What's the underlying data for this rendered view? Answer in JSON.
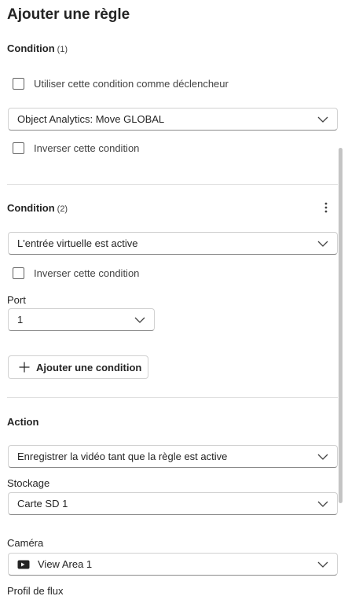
{
  "title": "Ajouter une règle",
  "condition1": {
    "label": "Condition",
    "count": "(1)",
    "trigger_checkbox_label": "Utiliser cette condition comme déclencheur",
    "select_value": "Object Analytics: Move GLOBAL",
    "invert_label": "Inverser cette condition"
  },
  "condition2": {
    "label": "Condition",
    "count": "(2)",
    "select_value": "L'entrée virtuelle est active",
    "invert_label": "Inverser cette condition",
    "port_label": "Port",
    "port_value": "1"
  },
  "add_condition_label": "Ajouter une condition",
  "action": {
    "label": "Action",
    "select_value": "Enregistrer la vidéo tant que la règle est active",
    "storage_label": "Stockage",
    "storage_value": "Carte SD 1",
    "camera_label": "Caméra",
    "camera_value": "View Area 1",
    "stream_profile_label": "Profil de flux"
  },
  "icons": {
    "dropdown": "chevron-down-icon",
    "more": "more-vertical-icon",
    "add": "plus-icon",
    "camera": "camera-icon"
  },
  "colors": {
    "text": "#242424",
    "border": "#d1d1d1",
    "divider": "#e0e0e0"
  }
}
